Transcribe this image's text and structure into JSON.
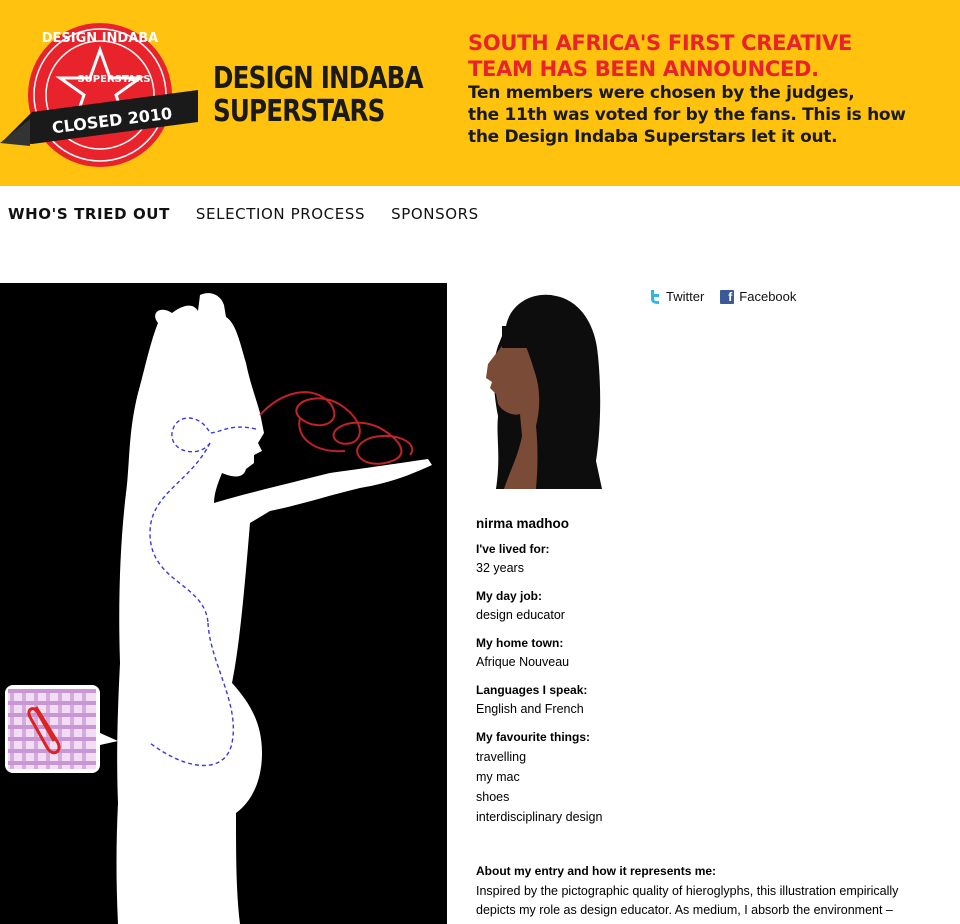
{
  "header": {
    "badge_top": "DESIGN INDABA",
    "badge_middle": "SUPERSTARS",
    "badge_ribbon": "CLOSED 2010",
    "logo_line1": "DESIGN INDABA",
    "logo_line2": "SUPERSTARS",
    "headline_line1": "SOUTH AFRICA'S FIRST CREATIVE",
    "headline_line2": "TEAM HAS BEEN ANNOUNCED.",
    "sub_line1": "Ten members were chosen by the judges,",
    "sub_line2": "the 11th was voted for by the fans. This is how",
    "sub_line3": "the Design Indaba Superstars let it out.",
    "colors": {
      "background": "#ffc20e",
      "headline": "#e8232b",
      "text": "#1a1a1a"
    }
  },
  "nav": {
    "items": [
      {
        "label": "WHO'S TRIED OUT",
        "active": true
      },
      {
        "label": "SELECTION PROCESS",
        "active": false
      },
      {
        "label": "SPONSORS",
        "active": false
      }
    ]
  },
  "social": {
    "twitter_label": "Twitter",
    "facebook_label": "Facebook",
    "twitter_icon": "twitter-icon",
    "facebook_icon": "facebook-icon"
  },
  "profile": {
    "name": "nirma madhoo",
    "lived_label": "I've lived for:",
    "lived_value": "32 years",
    "job_label": "My day job:",
    "job_value": "design educator",
    "hometown_label": "My home town:",
    "hometown_value": "Afrique Nouveau",
    "languages_label": "Languages I speak:",
    "languages_value": "English and French",
    "things_label": "My favourite things:",
    "things": [
      "travelling",
      "my mac",
      "shoes",
      "interdisciplinary design"
    ],
    "about_label": "About my entry and how it represents me:",
    "about_line1": "Inspired by the pictographic quality of hieroglyphs, this illustration empirically",
    "about_line2": "depicts my role as design educator. As medium, I absorb the environment –"
  }
}
